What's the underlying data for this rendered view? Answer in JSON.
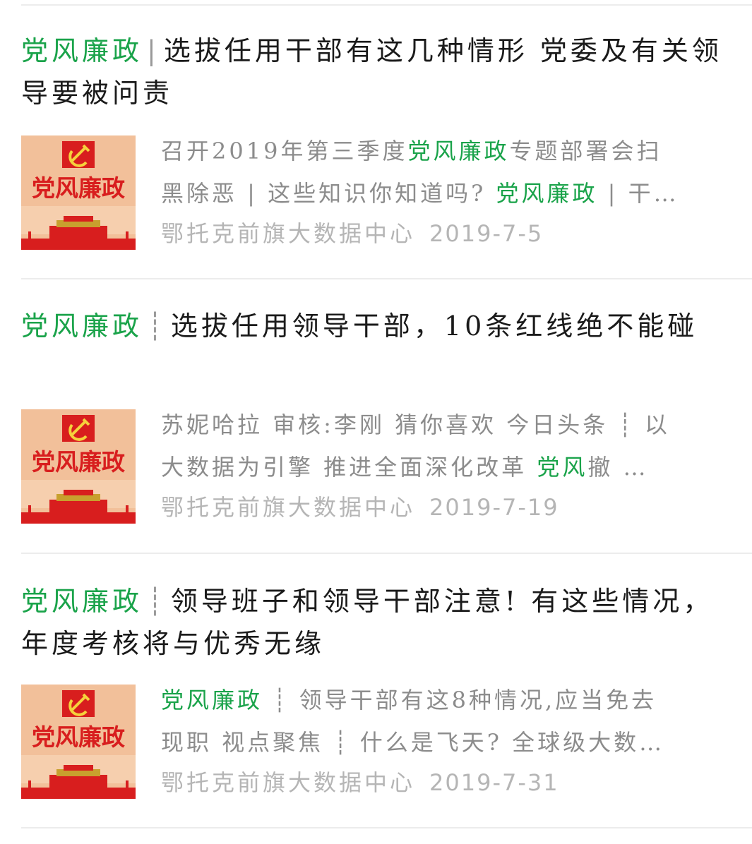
{
  "tag_keyword": "党风廉政",
  "articles": [
    {
      "title_sep": "|",
      "title_rest": "选拔任用干部有这几种情形 党委及有关领导要被问责",
      "snippet_l1_a": "召开2019年第三季度",
      "snippet_l1_hl": "党风廉政",
      "snippet_l1_b": "专题部署会扫",
      "snippet_l2_a": "黑除恶 | 这些知识你知道吗? ",
      "snippet_l2_hl": "党风廉政",
      "snippet_l2_b": " | 干…",
      "source": "鄂托克前旗大数据中心",
      "date": "2019-7-5"
    },
    {
      "title_sep": "┊",
      "title_rest": "选拔任用领导干部，10条红线绝不能碰",
      "snippet_l1_a": "苏妮哈拉 审核:李刚 猜你喜欢 今日头条 ┊ 以",
      "snippet_l2_a": "大数据为引擎 推进全面深化改革 ",
      "snippet_l2_hl": "党风",
      "snippet_l2_b": "撤 …",
      "source": "鄂托克前旗大数据中心",
      "date": "2019-7-19"
    },
    {
      "title_sep": "┊",
      "title_rest": "领导班子和领导干部注意! 有这些情况，年度考核将与优秀无缘",
      "snippet_l1_hl": "党风廉政",
      "snippet_l1_b": " ┊ 领导干部有这8种情况,应当免去",
      "snippet_l2_a": "现职 视点聚焦 ┊ 什么是飞天? 全球级大数…",
      "source": "鄂托克前旗大数据中心",
      "date": "2019-7-31"
    }
  ],
  "thumbnail": {
    "logo_text": "党风廉政",
    "emblem": "hammer-and-sickle-icon",
    "colors": {
      "bg": "#f2c09a",
      "red": "#d81e1e",
      "gold": "#f5d23c"
    }
  },
  "colors": {
    "highlight": "#1aa34a",
    "title": "#1a1a1a",
    "snippet": "#8c8c8c",
    "meta": "#b5b5b5",
    "divider": "#ececec"
  }
}
